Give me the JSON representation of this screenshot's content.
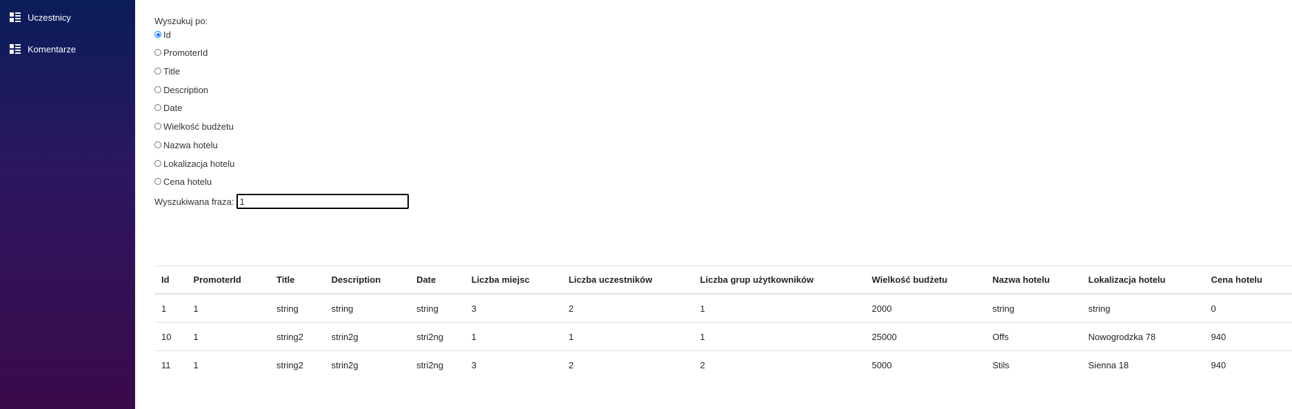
{
  "sidebar": {
    "items": [
      {
        "label": "Uczestnicy",
        "icon": "list-icon"
      },
      {
        "label": "Komentarze",
        "icon": "list-icon"
      }
    ]
  },
  "search": {
    "label": "Wyszukuj po:",
    "options": [
      "Id",
      "PromoterId",
      "Title",
      "Description",
      "Date",
      "Wielkość budżetu",
      "Nazwa hotelu",
      "Lokalizacja hotelu",
      "Cena hotelu"
    ],
    "selected": "Id",
    "phrase_label": "Wyszukiwana fraza:",
    "phrase_value": "1"
  },
  "table": {
    "headers": [
      "Id",
      "PromoterId",
      "Title",
      "Description",
      "Date",
      "Liczba miejsc",
      "Liczba uczestników",
      "Liczba grup użytkowników",
      "Wielkość budżetu",
      "Nazwa hotelu",
      "Lokalizacja hotelu",
      "Cena hotelu"
    ],
    "rows": [
      [
        "1",
        "1",
        "string",
        "string",
        "string",
        "3",
        "2",
        "1",
        "2000",
        "string",
        "string",
        "0"
      ],
      [
        "10",
        "1",
        "string2",
        "strin2g",
        "stri2ng",
        "1",
        "1",
        "1",
        "25000",
        "Offs",
        "Nowogrodzka 78",
        "940"
      ],
      [
        "11",
        "1",
        "string2",
        "strin2g",
        "stri2ng",
        "3",
        "2",
        "2",
        "5000",
        "Stils",
        "Sienna 18",
        "940"
      ]
    ]
  },
  "colors": {
    "sidebar_top": "#0a1d5a",
    "sidebar_bottom": "#3a0a4a",
    "radio_checked": "#0075ff",
    "table_border": "#dee2e6"
  }
}
